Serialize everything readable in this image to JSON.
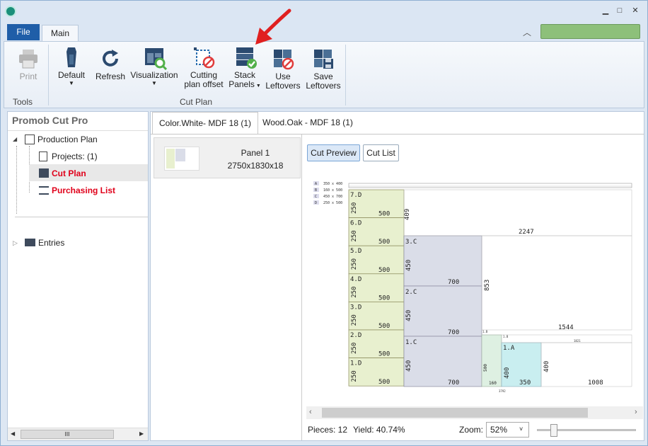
{
  "window": {
    "min": "▁",
    "max": "□",
    "close": "✕"
  },
  "tabs": {
    "file": "File",
    "main": "Main"
  },
  "ribbon": {
    "print": "Print",
    "tools_label": "Tools",
    "default": "Default",
    "refresh": "Refresh",
    "visualization": "Visualization",
    "cutting_offset_1": "Cutting",
    "cutting_offset_2": "plan offset",
    "stack_1": "Stack",
    "stack_2": "Panels",
    "use_1": "Use",
    "use_2": "Leftovers",
    "save_1": "Save",
    "save_2": "Leftovers",
    "cutplan_label": "Cut Plan"
  },
  "left": {
    "title": "Promob Cut Pro",
    "production_plan": "Production Plan",
    "projects": "Projects: (1)",
    "cut_plan": "Cut Plan",
    "purchasing_list": "Purchasing List",
    "entries": "Entries",
    "scroll_grip": "III"
  },
  "main": {
    "tab1": "Color.White- MDF 18 (1)",
    "tab2": "Wood.Oak - MDF 18 (1)",
    "panel_name": "Panel 1",
    "panel_size": "2750x1830x18",
    "cut_preview": "Cut Preview",
    "cut_list": "Cut List"
  },
  "legend": [
    {
      "k": "A",
      "v": "350 x 400"
    },
    {
      "k": "B",
      "v": "160 x 500"
    },
    {
      "k": "C",
      "v": "450 x 700"
    },
    {
      "k": "D",
      "v": "250 x 500"
    }
  ],
  "pieces": {
    "d": [
      {
        "label": "7.D",
        "w": "500",
        "h": "250"
      },
      {
        "label": "6.D",
        "w": "500",
        "h": "250"
      },
      {
        "label": "5.D",
        "w": "500",
        "h": "250"
      },
      {
        "label": "4.D",
        "w": "500",
        "h": "250"
      },
      {
        "label": "3.D",
        "w": "500",
        "h": "250"
      },
      {
        "label": "2.D",
        "w": "500",
        "h": "250"
      },
      {
        "label": "1.D",
        "w": "500",
        "h": "250"
      }
    ],
    "c": [
      {
        "label": "3.C",
        "w": "700",
        "h": "450"
      },
      {
        "label": "2.C",
        "w": "700",
        "h": "450"
      },
      {
        "label": "1.C",
        "w": "700",
        "h": "450"
      }
    ],
    "a_label": "1.A",
    "a_w": "350",
    "a_h": "400",
    "b_label": "1.B",
    "b_w": "160",
    "b_h": "500"
  },
  "dims": {
    "d409": "409",
    "d2247": "2247",
    "d853": "853",
    "d1544": "1544",
    "d400": "400",
    "d1008": "1008",
    "tiny1": "1.B",
    "tiny2": "1821",
    "tiny3": "3792"
  },
  "status": {
    "pieces": "Pieces: 12",
    "yield": "Yield: 40.74%",
    "zoom_label": "Zoom:",
    "zoom_value": "52%"
  },
  "colors": {
    "d_fill": "#e8f0cf",
    "c_fill": "#dadde8",
    "a_fill": "#c9eef0",
    "b_fill": "#def0e2",
    "red_text": "#e0001a",
    "file_tab": "#1f5ea8"
  }
}
